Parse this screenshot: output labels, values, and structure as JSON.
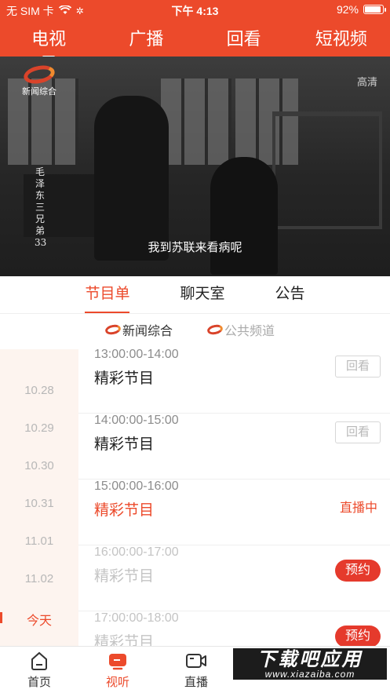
{
  "status_bar": {
    "carrier": "无 SIM 卡",
    "time": "下午 4:13",
    "battery": "92%",
    "battery_level": 0.92
  },
  "top_tabs": [
    {
      "label": "电视",
      "active": true
    },
    {
      "label": "广播",
      "active": false
    },
    {
      "label": "回看",
      "active": false
    },
    {
      "label": "短视频",
      "active": false
    }
  ],
  "video": {
    "channel_logo_text": "新闻综合",
    "quality": "高清",
    "show_title": "毛泽东三兄弟",
    "episode": "33",
    "subtitle": "我到苏联来看病呢"
  },
  "sub_tabs": [
    {
      "label": "节目单",
      "active": true
    },
    {
      "label": "聊天室",
      "active": false
    },
    {
      "label": "公告",
      "active": false
    }
  ],
  "channels": [
    {
      "label": "新闻综合",
      "active": true
    },
    {
      "label": "公共频道",
      "active": false
    }
  ],
  "dates": [
    {
      "label": "10.28",
      "active": false
    },
    {
      "label": "10.29",
      "active": false
    },
    {
      "label": "10.30",
      "active": false
    },
    {
      "label": "10.31",
      "active": false
    },
    {
      "label": "11.01",
      "active": false
    },
    {
      "label": "11.02",
      "active": false
    },
    {
      "label": "今天",
      "active": true
    }
  ],
  "programs": [
    {
      "time": "13:00:00-14:00",
      "name": "精彩节目",
      "state": "past",
      "action": "回看"
    },
    {
      "time": "14:00:00-15:00",
      "name": "精彩节目",
      "state": "past",
      "action": "回看"
    },
    {
      "time": "15:00:00-16:00",
      "name": "精彩节目",
      "state": "live",
      "action": "直播中"
    },
    {
      "time": "16:00:00-17:00",
      "name": "精彩节目",
      "state": "future",
      "action": "预约"
    },
    {
      "time": "17:00:00-18:00",
      "name": "精彩节目",
      "state": "future",
      "action": "预约"
    }
  ],
  "bottom_nav": [
    {
      "label": "首页",
      "icon": "home-icon",
      "active": false
    },
    {
      "label": "视听",
      "icon": "tv-icon",
      "active": true
    },
    {
      "label": "直播",
      "icon": "video-camera-icon",
      "active": false
    }
  ],
  "watermark": {
    "title": "下载吧应用",
    "url": "www.xiazaiba.com"
  },
  "colors": {
    "accent": "#ec4a2b",
    "reserve_button": "#e53a2c",
    "date_sidebar_bg": "#fdf4ef"
  }
}
